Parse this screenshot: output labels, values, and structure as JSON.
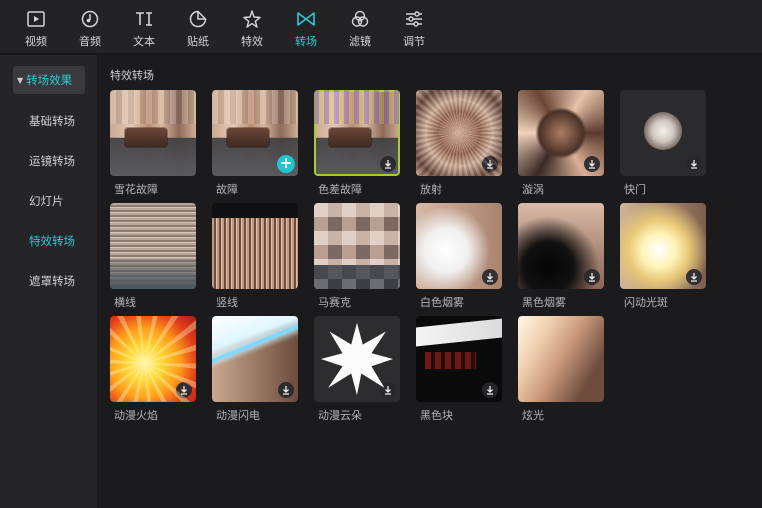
{
  "toolbar": {
    "tabs": [
      {
        "label": "视频",
        "icon": "play-square-icon"
      },
      {
        "label": "音频",
        "icon": "music-note-icon"
      },
      {
        "label": "文本",
        "icon": "text-ti-icon"
      },
      {
        "label": "贴纸",
        "icon": "sticker-icon"
      },
      {
        "label": "特效",
        "icon": "sparkle-star-icon"
      },
      {
        "label": "转场",
        "icon": "bowtie-transition-icon",
        "active": true
      },
      {
        "label": "滤镜",
        "icon": "filter-circles-icon"
      },
      {
        "label": "调节",
        "icon": "sliders-icon"
      }
    ],
    "accent_color": "#2fc9d6"
  },
  "sidebar": {
    "items": [
      {
        "label": "转场效果",
        "type": "group-header",
        "expanded": true
      },
      {
        "label": "基础转场"
      },
      {
        "label": "运镜转场"
      },
      {
        "label": "幻灯片"
      },
      {
        "label": "特效转场",
        "selected": true
      },
      {
        "label": "遮罩转场"
      }
    ]
  },
  "main": {
    "section_title": "特效转场",
    "items": [
      {
        "label": "雪花故障",
        "action": "none"
      },
      {
        "label": "故障",
        "action": "add"
      },
      {
        "label": "色差故障",
        "action": "download"
      },
      {
        "label": "放射",
        "action": "download"
      },
      {
        "label": "漩涡",
        "action": "download"
      },
      {
        "label": "快门",
        "action": "download"
      },
      {
        "label": "横线",
        "action": "none"
      },
      {
        "label": "竖线",
        "action": "download"
      },
      {
        "label": "马赛克",
        "action": "download"
      },
      {
        "label": "白色烟雾",
        "action": "download"
      },
      {
        "label": "黑色烟雾",
        "action": "download"
      },
      {
        "label": "闪动光斑",
        "action": "download"
      },
      {
        "label": "动漫火焰",
        "action": "download"
      },
      {
        "label": "动漫闪电",
        "action": "download"
      },
      {
        "label": "动漫云朵",
        "action": "download"
      },
      {
        "label": "黑色块",
        "action": "download"
      },
      {
        "label": "炫光",
        "action": "none"
      }
    ]
  }
}
